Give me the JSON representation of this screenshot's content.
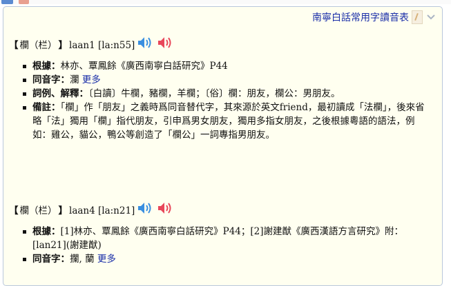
{
  "panel": {
    "title": "南寧白話常用字讀音表"
  },
  "entries": [
    {
      "head_open": "【",
      "char": "欄（栏）",
      "head_close": "】",
      "roman": "laan1 [la:n55]",
      "defs": [
        {
          "label": "根據：",
          "text": "林亦、覃鳳餘《廣西南寧白話研究》P44"
        },
        {
          "label": "同音字：",
          "text": "瀾",
          "more": "更多"
        },
        {
          "label": "詞例、解釋：",
          "text": "〔白讀〕牛欄，豬欄，羊欄；〔俗〕欄：朋友，欄公：男朋友。"
        },
        {
          "label": "備註：",
          "text": "「欄」作「朋友」之義時爲同音替代字，其來源於英文friend，最初讀成「法欄」，後來省略「法」獨用「欄」指代朋友，引申爲男女朋友，獨用多指女朋友，之後根據粵語的語法，例如：雞公，貓公，鴨公等創造了「欄公」一詞專指男朋友。"
        }
      ]
    },
    {
      "head_open": "【",
      "char": "欄（栏）",
      "head_close": "】",
      "roman": "laan4 [la:n21]",
      "defs": [
        {
          "label": "根據：",
          "text": "[1]林亦、覃鳳餘《廣西南寧白話研究》P44；[2]謝建猷《廣西漢語方言研究》附：[lan21](謝建猷)"
        },
        {
          "label": "同音字：",
          "text": "攔, 蘭",
          "more": "更多"
        }
      ]
    }
  ],
  "colors": {
    "panel_bg": "#fffff0",
    "link": "#1a2ea8",
    "speaker_blue": "#3a8fe0",
    "speaker_red": "#e8475a"
  }
}
